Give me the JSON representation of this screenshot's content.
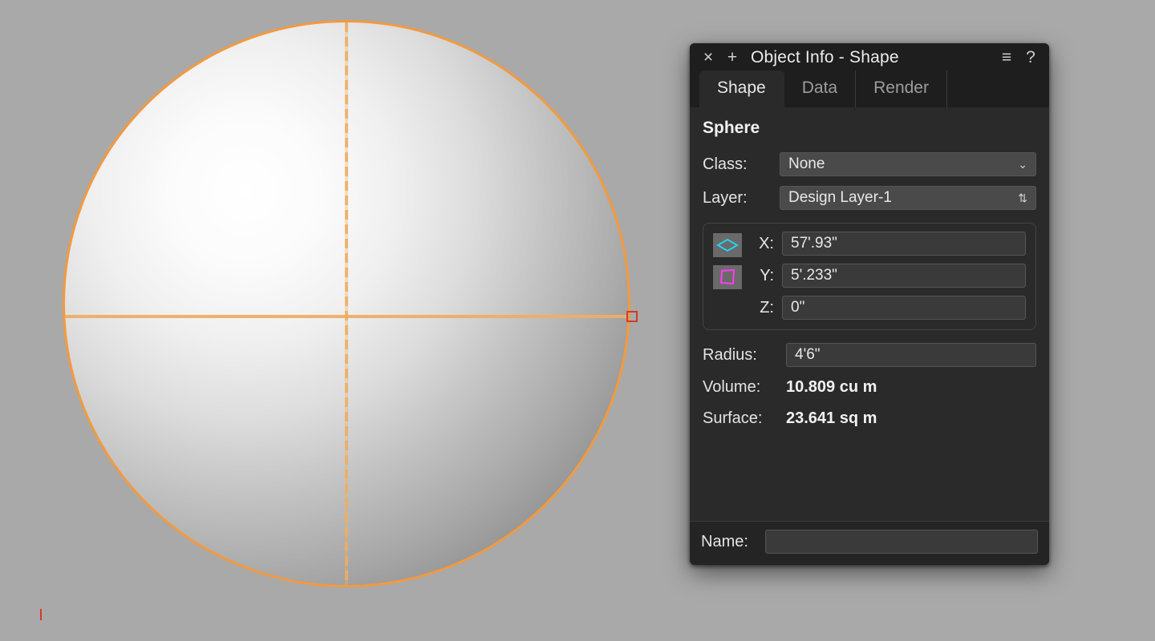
{
  "panel": {
    "title": "Object Info - Shape",
    "tabs": [
      "Shape",
      "Data",
      "Render"
    ],
    "active_tab": 0,
    "object_type": "Sphere",
    "class_label": "Class:",
    "class_value": "None",
    "layer_label": "Layer:",
    "layer_value": "Design Layer-1",
    "coords": {
      "x_label": "X:",
      "x_value": "57'.93\"",
      "y_label": "Y:",
      "y_value": "5'.233\"",
      "z_label": "Z:",
      "z_value": "0\""
    },
    "radius_label": "Radius:",
    "radius_value": "4'6\"",
    "volume_label": "Volume:",
    "volume_value": "10.809 cu m",
    "surface_label": "Surface:",
    "surface_value": "23.641 sq m",
    "name_label": "Name:",
    "name_value": ""
  },
  "icons": {
    "close": "×",
    "add": "+",
    "menu": "≡",
    "help": "?",
    "caret_down": "⌄",
    "caret_updown": "⇅"
  }
}
